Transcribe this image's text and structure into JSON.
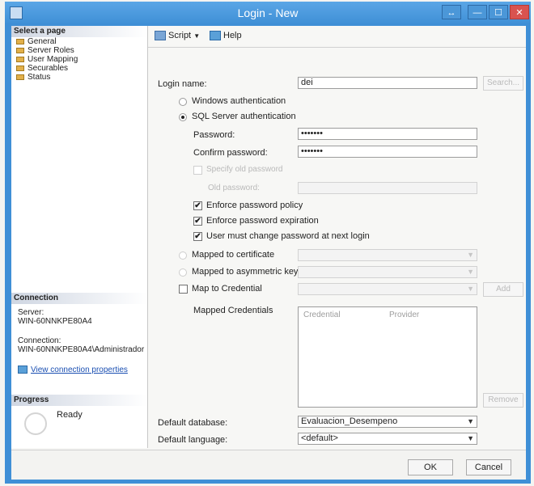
{
  "window": {
    "title": "Login - New",
    "controls": {
      "restore": "↔",
      "minimize": "—",
      "maximize": "☐",
      "close": "✕"
    }
  },
  "left_panel": {
    "select_page_header": "Select a page",
    "pages": [
      "General",
      "Server Roles",
      "User Mapping",
      "Securables",
      "Status"
    ],
    "connection_header": "Connection",
    "server_label": "Server:",
    "server_value": "WIN-60NNKPE80A4",
    "connection_label": "Connection:",
    "connection_value": "WIN-60NNKPE80A4\\Administrador",
    "view_connection_link": "View connection properties",
    "progress_header": "Progress",
    "progress_status": "Ready"
  },
  "toolbar": {
    "script": "Script",
    "help": "Help"
  },
  "form": {
    "login_name_label": "Login name:",
    "login_name_value": "dei",
    "search_button": "Search...",
    "windows_auth": "Windows authentication",
    "sql_auth": "SQL Server authentication",
    "password_label": "Password:",
    "password_value": "•••••••",
    "confirm_password_label": "Confirm password:",
    "confirm_password_value": "•••••••",
    "specify_old_password": "Specify old password",
    "old_password_label": "Old password:",
    "enforce_policy": "Enforce password policy",
    "enforce_expiration": "Enforce password expiration",
    "must_change": "User must change password at next login",
    "mapped_certificate": "Mapped to certificate",
    "mapped_asym_key": "Mapped to asymmetric key",
    "map_credential": "Map to Credential",
    "add_button": "Add",
    "mapped_credentials_label": "Mapped Credentials",
    "grid_headers": [
      "Credential",
      "Provider"
    ],
    "remove_button": "Remove",
    "default_database_label": "Default database:",
    "default_database_value": "Evaluacion_Desempeno",
    "default_language_label": "Default language:",
    "default_language_value": "<default>"
  },
  "footer": {
    "ok": "OK",
    "cancel": "Cancel"
  }
}
